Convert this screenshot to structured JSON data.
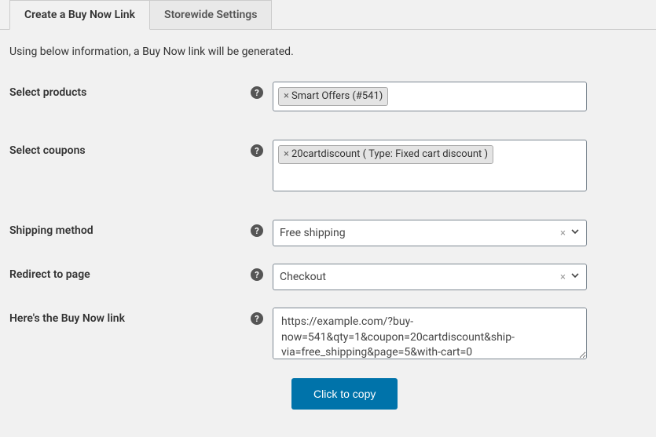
{
  "tabs": {
    "active": "Create a Buy Now Link",
    "inactive": "Storewide Settings"
  },
  "description": "Using below information, a Buy Now link will be generated.",
  "fields": {
    "products": {
      "label": "Select products",
      "tags": [
        "Smart Offers (#541)"
      ]
    },
    "coupons": {
      "label": "Select coupons",
      "tags": [
        "20cartdiscount ( Type: Fixed cart discount )"
      ]
    },
    "shipping": {
      "label": "Shipping method",
      "value": "Free shipping"
    },
    "redirect": {
      "label": "Redirect to page",
      "value": "Checkout"
    },
    "link": {
      "label": "Here's the Buy Now link",
      "value": "https://example.com/?buy-now=541&qty=1&coupon=20cartdiscount&ship-via=free_shipping&page=5&with-cart=0"
    }
  },
  "button": "Click to copy",
  "help_glyph": "?"
}
